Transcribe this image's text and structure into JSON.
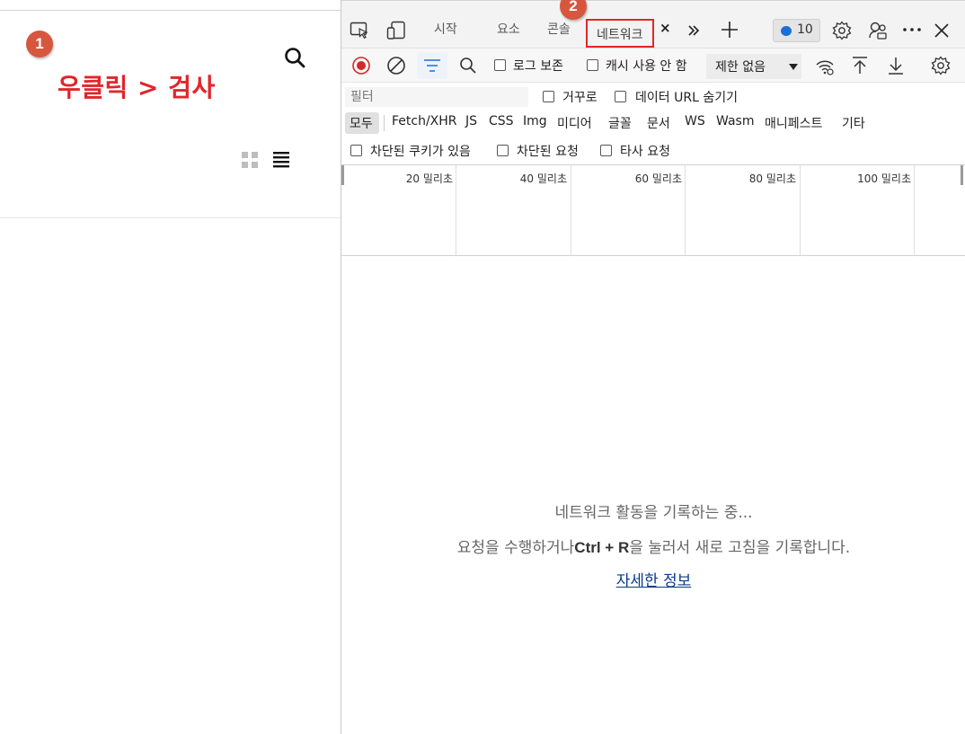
{
  "page": {
    "instruction": "우클릭 > 검사",
    "step1": "1",
    "step2": "2"
  },
  "devtools": {
    "tabs": {
      "start": "시작",
      "elements": "요소",
      "console": "콘솔",
      "network": "네트워크",
      "close": "×"
    },
    "message_count": "10",
    "toolbar": {
      "preserve_log": "로그 보존",
      "disable_cache": "캐시 사용 안 함",
      "throttling": "제한 없음"
    },
    "filter": {
      "placeholder": "필터",
      "invert": "거꾸로",
      "hide_data_urls": "데이터 URL 숨기기",
      "types": [
        "모두",
        "Fetch/XHR",
        "JS",
        "CSS",
        "Img",
        "미디어",
        "글꼴",
        "문서",
        "WS",
        "Wasm",
        "매니페스트",
        "기타"
      ],
      "blocked_cookies": "차단된 쿠키가 있음",
      "blocked_requests": "차단된 요청",
      "third_party": "타사 요청"
    },
    "timeline_labels": [
      "20 밀리초",
      "40 밀리초",
      "60 밀리초",
      "80 밀리초",
      "100 밀리초"
    ],
    "empty_state": {
      "recording": "네트워크 활동을 기록하는 중...",
      "hint_before": "요청을 수행하거나",
      "shortcut": "Ctrl + R",
      "hint_after": "을 눌러서 새로 고침을 기록합니다.",
      "learn_more": "자세한 정보"
    }
  },
  "colors": {
    "accent_red": "#e0262b",
    "badge": "#d6573e",
    "link": "#0b3a8c",
    "record": "#d42a2a"
  }
}
